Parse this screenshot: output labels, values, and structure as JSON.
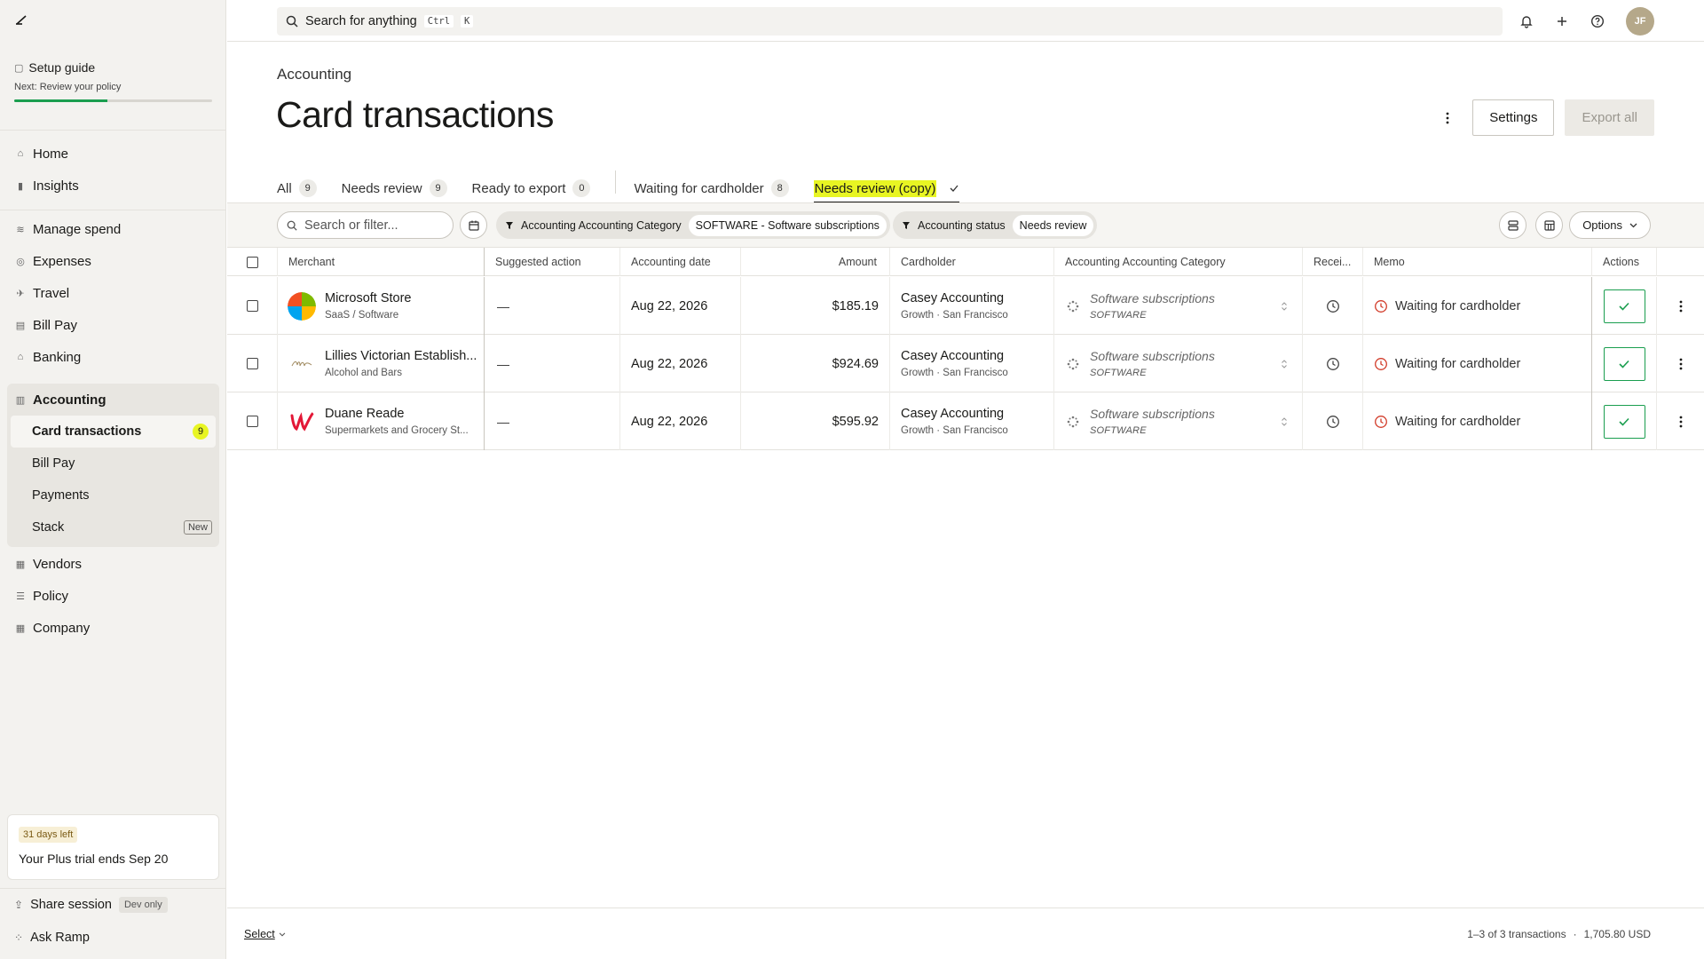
{
  "sidebar": {
    "setup": {
      "label": "Setup guide",
      "next": "Next: Review your policy",
      "progress": 0.47
    },
    "nav_top": [
      {
        "label": "Home",
        "icon": "home-icon"
      },
      {
        "label": "Insights",
        "icon": "bar-chart-icon"
      }
    ],
    "nav_mid": [
      {
        "label": "Manage spend",
        "icon": "layers-icon"
      },
      {
        "label": "Expenses",
        "icon": "dollar-circle-icon"
      },
      {
        "label": "Travel",
        "icon": "plane-icon"
      },
      {
        "label": "Bill Pay",
        "icon": "receipt-icon"
      },
      {
        "label": "Banking",
        "icon": "bank-icon"
      }
    ],
    "accounting": {
      "label": "Accounting",
      "items": [
        {
          "label": "Card transactions",
          "count": "9"
        },
        {
          "label": "Bill Pay"
        },
        {
          "label": "Payments"
        },
        {
          "label": "Stack",
          "badge": "New"
        }
      ]
    },
    "nav_bottom": [
      {
        "label": "Vendors",
        "icon": "store-icon"
      },
      {
        "label": "Policy",
        "icon": "sliders-icon"
      },
      {
        "label": "Company",
        "icon": "building-icon"
      }
    ],
    "trial": {
      "badge": "31 days left",
      "text": "Your Plus trial ends Sep 20"
    },
    "share": {
      "label": "Share session",
      "badge": "Dev only"
    },
    "ask": {
      "label": "Ask Ramp"
    }
  },
  "topbar": {
    "search_placeholder": "Search for anything",
    "shortcut_1": "Ctrl",
    "shortcut_2": "K",
    "avatar_initials": "JF"
  },
  "header": {
    "breadcrumb": "Accounting",
    "title": "Card transactions",
    "settings_label": "Settings",
    "export_label": "Export all"
  },
  "tabs": [
    {
      "label": "All",
      "count": "9"
    },
    {
      "label": "Needs review",
      "count": "9"
    },
    {
      "label": "Ready to export",
      "count": "0"
    },
    {
      "label": "Waiting for cardholder",
      "count": "8"
    },
    {
      "label": "Needs review (copy)"
    }
  ],
  "filters": {
    "search_placeholder": "Search or filter...",
    "chip1_label": "Accounting Accounting Category",
    "chip1_value": "SOFTWARE - Software subscriptions",
    "chip2_label": "Accounting status",
    "chip2_value": "Needs review",
    "options_label": "Options"
  },
  "table": {
    "columns": [
      "Merchant",
      "Suggested action",
      "Accounting date",
      "Amount",
      "Cardholder",
      "Accounting Accounting Category",
      "Recei...",
      "Memo",
      "Actions"
    ],
    "rows": [
      {
        "merchant": "Microsoft Store",
        "merchant_sub": "SaaS / Software",
        "logo": "microsoft",
        "suggested": "—",
        "date": "Aug 22, 2026",
        "amount": "$185.19",
        "cardholder": "Casey Accounting",
        "cardholder_sub": "Growth · San Francisco",
        "category": "Software subscriptions",
        "category_code": "SOFTWARE",
        "memo": "Waiting for cardholder"
      },
      {
        "merchant": "Lillies Victorian Establish...",
        "merchant_sub": "Alcohol and Bars",
        "logo": "lillies",
        "suggested": "—",
        "date": "Aug 22, 2026",
        "amount": "$924.69",
        "cardholder": "Casey Accounting",
        "cardholder_sub": "Growth · San Francisco",
        "category": "Software subscriptions",
        "category_code": "SOFTWARE",
        "memo": "Waiting for cardholder"
      },
      {
        "merchant": "Duane Reade",
        "merchant_sub": "Supermarkets and Grocery St...",
        "logo": "walgreens",
        "suggested": "—",
        "date": "Aug 22, 2026",
        "amount": "$595.92",
        "cardholder": "Casey Accounting",
        "cardholder_sub": "Growth · San Francisco",
        "category": "Software subscriptions",
        "category_code": "SOFTWARE",
        "memo": "Waiting for cardholder"
      }
    ]
  },
  "footer": {
    "select_label": "Select",
    "count_text": "1–3 of 3 transactions",
    "separator": "·",
    "total_text": "1,705.80 USD"
  },
  "colors": {
    "accent_yellow": "#e8f523",
    "approve_green": "#1a9e4f",
    "memo_red": "#d23c2a",
    "progress_green": "#1a9e4f"
  }
}
